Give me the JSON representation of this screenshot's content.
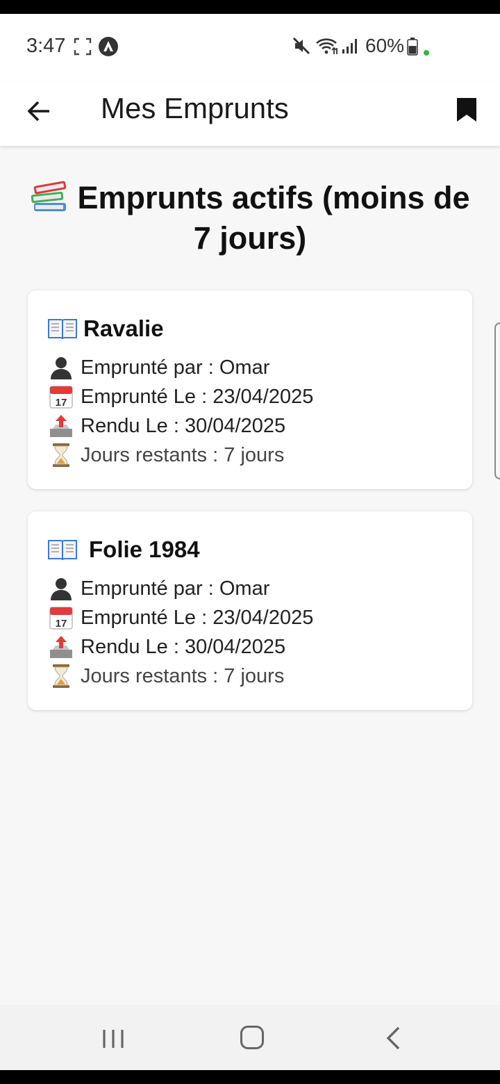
{
  "status_bar": {
    "time": "3:47",
    "battery_percent": "60%",
    "battery_level": 0.6,
    "icons": [
      "screenshot-icon",
      "app-notification-icon",
      "mute-icon",
      "wifi-icon",
      "signal-icon",
      "battery-icon"
    ]
  },
  "app_bar": {
    "title": "Mes Emprunts",
    "back_icon": "arrow-left-icon",
    "action_icon": "bookmark-icon"
  },
  "section": {
    "heading": "Emprunts actifs (moins de 7 jours)",
    "heading_icon": "books-emoji-icon"
  },
  "loans": [
    {
      "title": "Ravalie",
      "borrowed_by": "Emprunté par : Omar",
      "borrowed_on": "Emprunté Le : 23/04/2025",
      "returned_on": "Rendu Le : 30/04/2025",
      "days_left": "Jours restants : 7 jours"
    },
    {
      "title": "Folie 1984",
      "borrowed_by": "Emprunté par : Omar",
      "borrowed_on": "Emprunté Le : 23/04/2025",
      "returned_on": "Rendu Le : 30/04/2025",
      "days_left": "Jours restants : 7 jours"
    }
  ],
  "nav_bar": {
    "buttons": [
      "recent-apps",
      "home",
      "back"
    ]
  },
  "colors": {
    "background": "#f7f7f7",
    "card": "#ffffff",
    "text": "#1a1a1a",
    "battery_dot": "#2fb64a"
  }
}
